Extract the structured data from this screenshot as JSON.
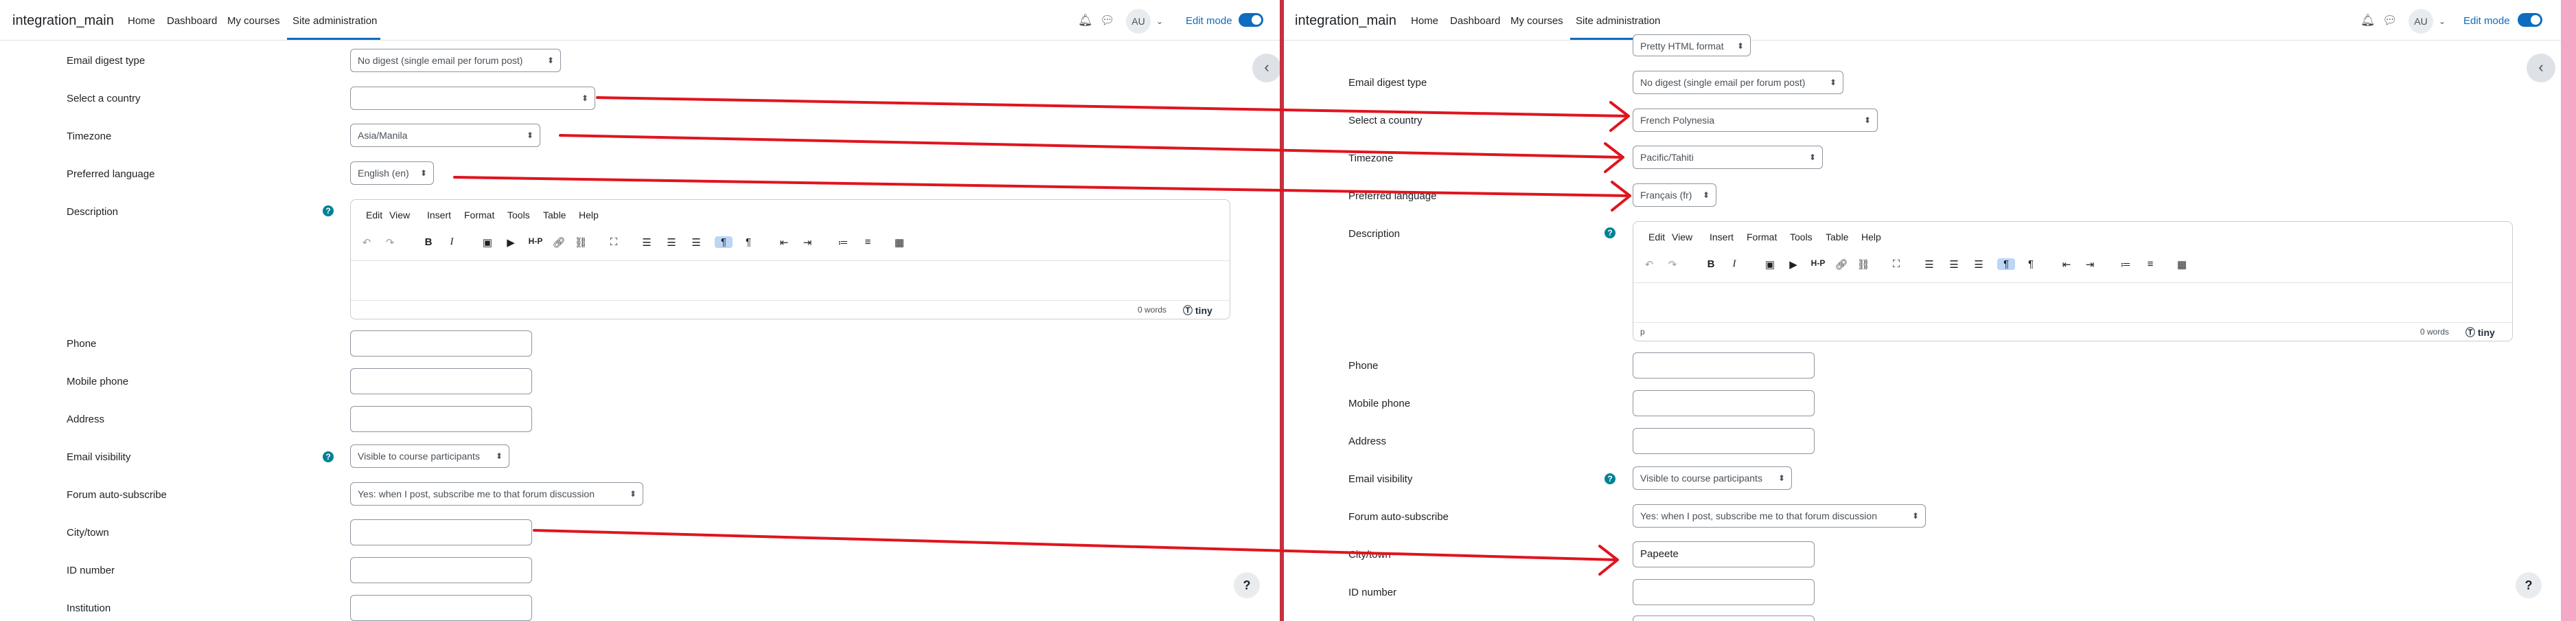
{
  "navbar": {
    "site_name": "integration_main",
    "links": [
      "Home",
      "Dashboard",
      "My courses",
      "Site administration"
    ],
    "avatar_initials": "AU",
    "edit_mode_label": "Edit mode",
    "active_color": "#0f6cbf"
  },
  "icons": {
    "bell": "bell-icon",
    "chat": "chat-icon",
    "chevron": "chevron-down-icon",
    "drawer": "chevron-left-icon",
    "help": "question-icon"
  },
  "editor": {
    "menu": [
      "Edit",
      "View",
      "Insert",
      "Format",
      "Tools",
      "Table",
      "Help"
    ],
    "word_count": "0 words",
    "brand": "tiny",
    "path": "p"
  },
  "left": {
    "email_digest": {
      "label": "Email digest type",
      "value": "No digest (single email per forum post)"
    },
    "country": {
      "label": "Select a country",
      "value": ""
    },
    "timezone": {
      "label": "Timezone",
      "value": "Asia/Manila"
    },
    "language": {
      "label": "Preferred language",
      "value": "English (en)"
    },
    "description": {
      "label": "Description"
    },
    "phone": {
      "label": "Phone"
    },
    "mobile": {
      "label": "Mobile phone"
    },
    "address": {
      "label": "Address"
    },
    "email_visibility": {
      "label": "Email visibility",
      "value": "Visible to course participants"
    },
    "forum_subscribe": {
      "label": "Forum auto-subscribe",
      "value": "Yes: when I post, subscribe me to that forum discussion"
    },
    "city": {
      "label": "City/town",
      "value": ""
    },
    "id_number": {
      "label": "ID number"
    },
    "institution": {
      "label": "Institution"
    }
  },
  "right": {
    "email_format": {
      "value": "Pretty HTML format"
    },
    "email_digest": {
      "label": "Email digest type",
      "value": "No digest (single email per forum post)"
    },
    "country": {
      "label": "Select a country",
      "value": "French Polynesia"
    },
    "timezone": {
      "label": "Timezone",
      "value": "Pacific/Tahiti"
    },
    "language": {
      "label": "Preferred language",
      "value": "Français (fr)"
    },
    "description": {
      "label": "Description"
    },
    "phone": {
      "label": "Phone"
    },
    "mobile": {
      "label": "Mobile phone"
    },
    "address": {
      "label": "Address"
    },
    "email_visibility": {
      "label": "Email visibility",
      "value": "Visible to course participants"
    },
    "forum_subscribe": {
      "label": "Forum auto-subscribe",
      "value": "Yes: when I post, subscribe me to that forum discussion"
    },
    "city": {
      "label": "City/town",
      "value": "Papeete"
    },
    "id_number": {
      "label": "ID number"
    }
  },
  "annotation_color": "#e0141e"
}
